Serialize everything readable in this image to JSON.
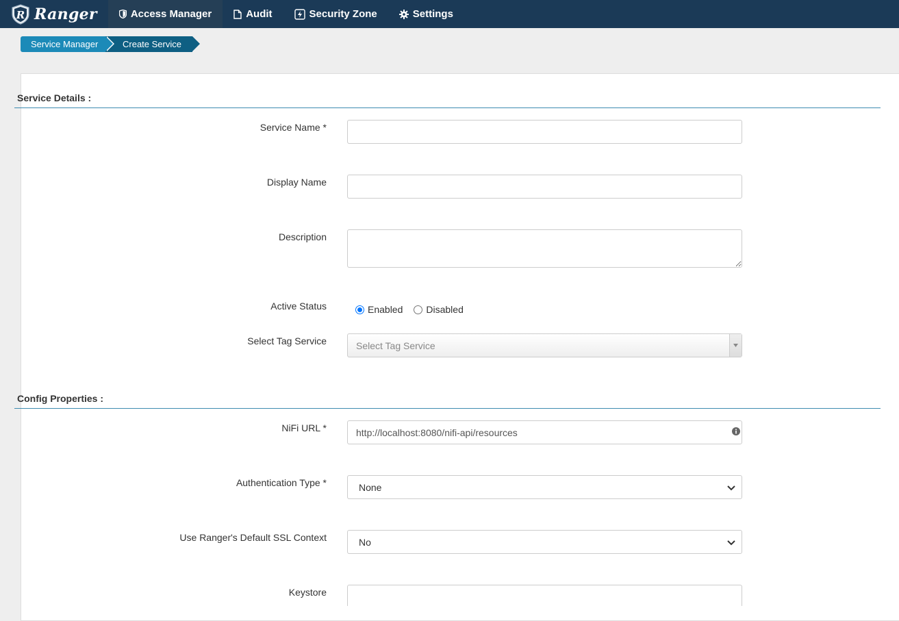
{
  "brand": {
    "name": "Ranger"
  },
  "nav": [
    {
      "label": "Access Manager",
      "icon": "shield-icon",
      "active": true
    },
    {
      "label": "Audit",
      "icon": "file-icon"
    },
    {
      "label": "Security Zone",
      "icon": "lightning-icon"
    },
    {
      "label": "Settings",
      "icon": "gear-icon"
    }
  ],
  "breadcrumb": [
    "Service Manager",
    "Create Service"
  ],
  "sections": {
    "service_details": "Service Details :",
    "config_properties": "Config Properties :"
  },
  "fields": {
    "service_name": {
      "label": "Service Name *",
      "value": ""
    },
    "display_name": {
      "label": "Display Name",
      "value": ""
    },
    "description": {
      "label": "Description",
      "value": ""
    },
    "active_status": {
      "label": "Active Status",
      "options": [
        "Enabled",
        "Disabled"
      ],
      "selected": "Enabled"
    },
    "tag_service": {
      "label": "Select Tag Service",
      "placeholder": "Select Tag Service"
    },
    "nifi_url": {
      "label": "NiFi URL *",
      "value": "http://localhost:8080/nifi-api/resources"
    },
    "auth_type": {
      "label": "Authentication Type *",
      "value": "None"
    },
    "ssl_context": {
      "label": "Use Ranger's Default SSL Context",
      "value": "No"
    },
    "keystore": {
      "label": "Keystore",
      "value": ""
    }
  },
  "colors": {
    "navbar": "#1b3a57",
    "crumb_primary": "#1c8ab8",
    "crumb_active": "#0e5f83",
    "section_rule": "#3d8bb0",
    "radio_accent": "#0075ff"
  }
}
